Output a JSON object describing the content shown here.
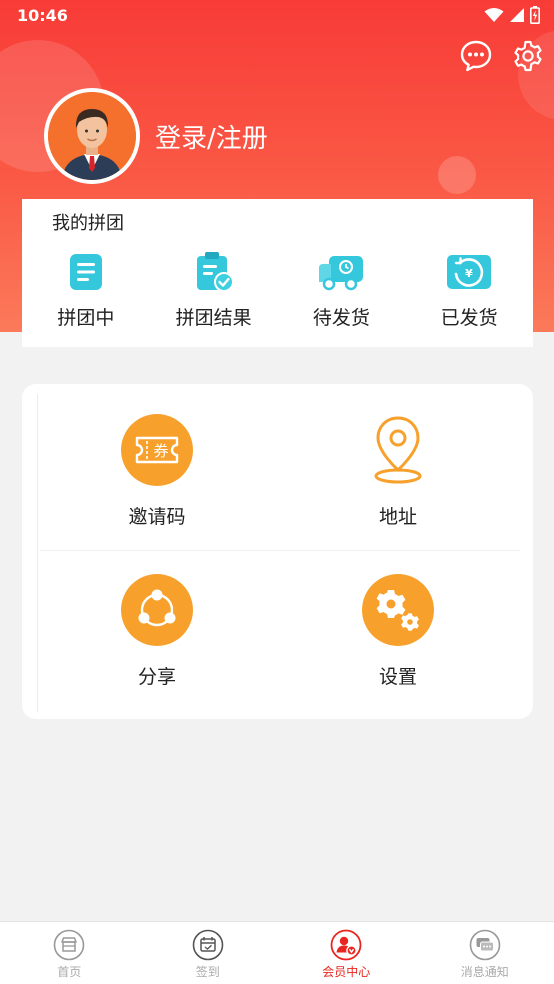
{
  "status_bar": {
    "time": "10:46"
  },
  "header": {
    "login_label": "登录/注册"
  },
  "group_card": {
    "title": "我的拼团",
    "items": [
      {
        "label": "拼团中",
        "icon": "document-icon"
      },
      {
        "label": "拼团结果",
        "icon": "clipboard-check-icon"
      },
      {
        "label": "待发货",
        "icon": "delivery-truck-icon"
      },
      {
        "label": "已发货",
        "icon": "yuan-refresh-icon"
      }
    ]
  },
  "menu": {
    "items": [
      {
        "label": "邀请码",
        "icon": "coupon-icon",
        "icon_text": "券"
      },
      {
        "label": "地址",
        "icon": "location-pin-icon"
      },
      {
        "label": "分享",
        "icon": "share-icon"
      },
      {
        "label": "设置",
        "icon": "gears-icon"
      }
    ]
  },
  "bottom_nav": {
    "items": [
      {
        "label": "首页",
        "icon": "store-icon"
      },
      {
        "label": "签到",
        "icon": "calendar-check-icon"
      },
      {
        "label": "会员中心",
        "icon": "member-icon",
        "active": true
      },
      {
        "label": "消息通知",
        "icon": "chat-icon"
      }
    ]
  },
  "colors": {
    "header_red": "#f83b37",
    "accent_orange": "#f7a12c",
    "group_icon_cyan": "#35c7dc",
    "nav_active": "#e8261f",
    "nav_inactive": "#aaaaaa"
  }
}
